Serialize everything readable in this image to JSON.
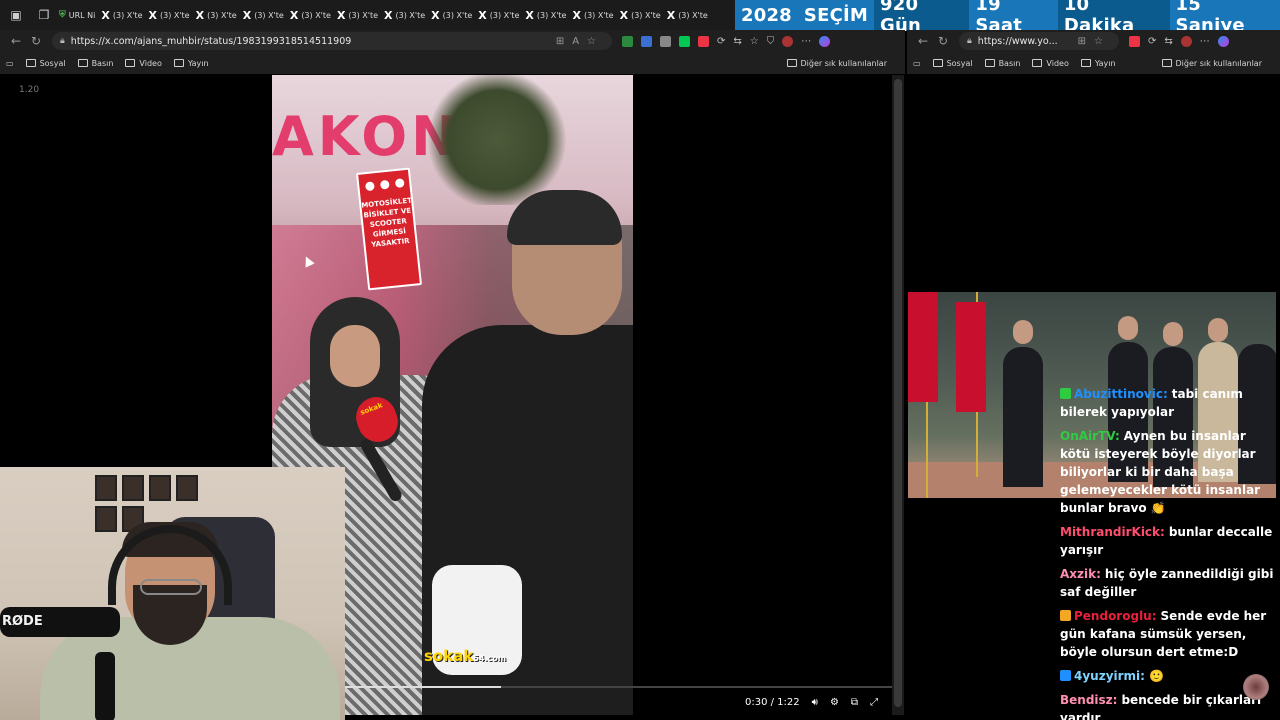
{
  "tabs": [
    {
      "label": "URL Ni",
      "icon": "shield-icon"
    },
    {
      "label": "(3) X'te",
      "icon": "x-icon"
    },
    {
      "label": "(3) X'te",
      "icon": "x-icon"
    },
    {
      "label": "(3) X'te",
      "icon": "x-icon"
    },
    {
      "label": "(3) X'te",
      "icon": "x-icon"
    },
    {
      "label": "(3) X'te",
      "icon": "x-icon"
    },
    {
      "label": "(3) X'te",
      "icon": "x-icon"
    },
    {
      "label": "(3) X'te",
      "icon": "x-icon"
    },
    {
      "label": "(3) X'te",
      "icon": "x-icon"
    },
    {
      "label": "(3) X'te",
      "icon": "x-icon"
    },
    {
      "label": "(3) X'te",
      "icon": "x-icon"
    },
    {
      "label": "(3) X'te",
      "icon": "x-icon"
    },
    {
      "label": "(3) X'te",
      "icon": "x-icon"
    },
    {
      "label": "(3) X'te",
      "icon": "x-icon"
    }
  ],
  "countdown": {
    "year": "2028",
    "title": "SEÇİM",
    "days": "920 Gün",
    "hours": "19 Saat",
    "minutes": "10 Dakika",
    "seconds": "15 Saniye"
  },
  "left_browser": {
    "url": "https://x.com/ajans_muhbir/status/1983199318514511909",
    "bookmarks": [
      "Sosyal",
      "Basın",
      "Video",
      "Yayın"
    ],
    "other_bookmarks": "Diğer sık kullanılanlar"
  },
  "right_browser": {
    "url": "https://www.yo...",
    "bookmarks": [
      "Sosyal",
      "Basın",
      "Video",
      "Yayın"
    ],
    "other_bookmarks": "Diğer sık kullanılanlar"
  },
  "video": {
    "duration_tag": "1.20",
    "time_display": "0:30 / 1:22",
    "progress": 0.37,
    "store_sign": "AKON",
    "road_sign": "MOTOSİKLET BİSİKLET VE SCOOTER GİRMESİ YASAKTIR",
    "mic_label": "sokak",
    "watermark": "sokak",
    "watermark_sub": "54.com"
  },
  "webcam": {
    "mic_brand": "RØDE"
  },
  "chat": [
    {
      "user": "Abuzittinovic:",
      "text": "tabi canım bilerek yapıyolar",
      "color": "#1e90ff",
      "badge": "#2ecc40"
    },
    {
      "user": "OnAirTV:",
      "text": "Aynen bu insanlar kötü isteyerek böyle diyorlar biliyorlar ki bir daha başa gelemeyecekler kötü insanlar bunlar bravo 👏",
      "color": "#2ecc40",
      "badge": ""
    },
    {
      "user": "MithrandirKick:",
      "text": "bunlar deccalle yarışır",
      "color": "#ff4d6d",
      "badge": ""
    },
    {
      "user": "Axzik:",
      "text": "hiç öyle zannedildiği gibi saf değiller",
      "color": "#ff8fb0",
      "badge": ""
    },
    {
      "user": "Pendoroglu:",
      "text": "Sende evde her gün kafana sümsük yersen, böyle olursun dert etme:D",
      "color": "#e8203a",
      "badge": "#f5a623"
    },
    {
      "user": "4yuzyirmi:",
      "text": "🙂",
      "color": "#7fd4ff",
      "badge": "#1e90ff"
    },
    {
      "user": "Bendisz:",
      "text": "bencede bir çıkarları vardır",
      "color": "#ff8fb0",
      "badge": ""
    }
  ]
}
